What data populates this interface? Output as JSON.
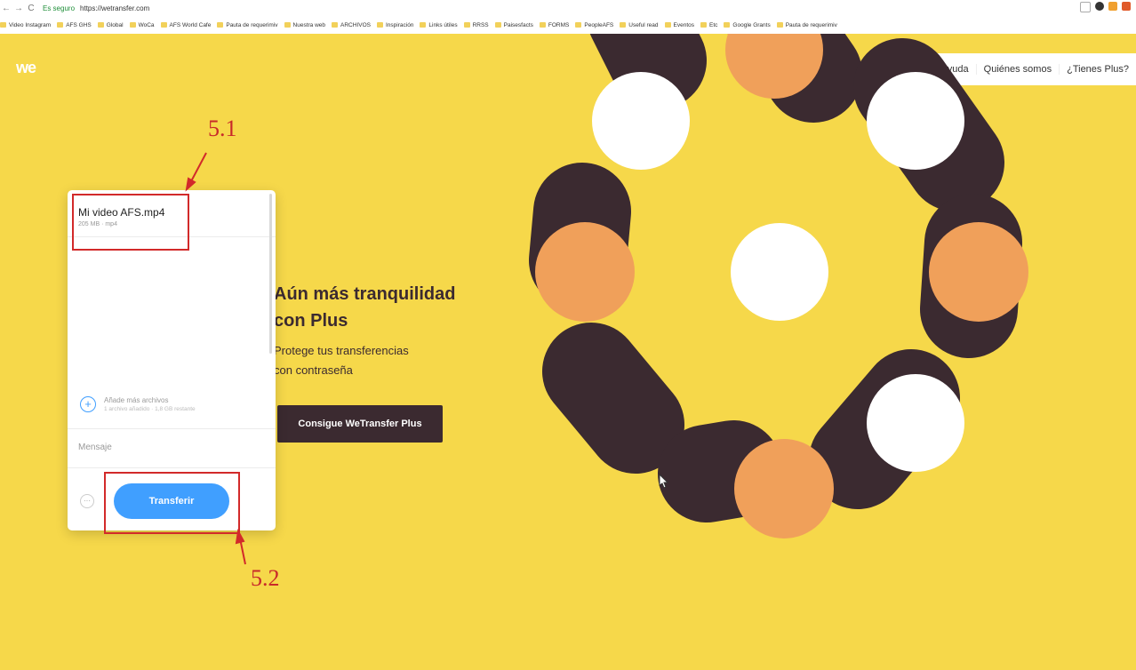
{
  "browser": {
    "nav_back": "←",
    "nav_forward": "→",
    "nav_reload": "C",
    "secure_label": "Es seguro",
    "url": "https://wetransfer.com",
    "bookmarks": [
      "Video Instagram",
      "AFS GHS",
      "Global",
      "WoCa",
      "AFS World Cafe",
      "Pauta de requerimiv",
      "Nuestra web",
      "ARCHIVOS",
      "Inspiración",
      "Links útiles",
      "RRSS",
      "Paisesfacts",
      "FORMS",
      "PeopleAFS",
      "Useful read",
      "Eventos",
      "Etc",
      "Google Grants",
      "Pauta de requerimiv"
    ]
  },
  "site": {
    "logo": "we",
    "nav": [
      "Ayuda",
      "Quiénes somos",
      "¿Tienes Plus?"
    ]
  },
  "promo": {
    "heading_line1": "Aún más tranquilidad",
    "heading_line2": "con Plus",
    "sub_line1": "Protege tus transferencias",
    "sub_line2": "con contraseña",
    "button": "Consigue WeTransfer Plus"
  },
  "panel": {
    "file_name": "Mi video AFS.mp4",
    "file_meta": "205 MB · mp4",
    "add_more_label": "Añade más archivos",
    "add_status": "1 archivo añadido · 1,8 GB restante",
    "message_placeholder": "Mensaje",
    "more_icon": "···",
    "transfer_button": "Transferir"
  },
  "annotations": {
    "callout_1": "5.1",
    "callout_2": "5.2"
  },
  "colors": {
    "background": "#f6d84a",
    "dark_circle": "#3b2a30",
    "orange_circle": "#f0a05a",
    "white_circle": "#ffffff",
    "transfer_blue": "#409fff",
    "annotation_red": "#d22a2a"
  }
}
